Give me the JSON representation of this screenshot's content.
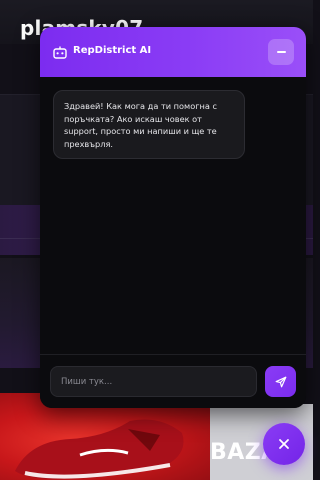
{
  "background": {
    "username": "plamsky07",
    "brand": "BAZAR"
  },
  "chat": {
    "title": "RepDistrict AI",
    "bot_icon": "robot-icon",
    "minimize_icon": "minus-icon",
    "welcome_message": "Здравей! Как мога да ти помогна с поръчката? Ако искаш човек от support, просто ми напиши и ще те прехвърля.",
    "input": {
      "placeholder": "Пиши тук...",
      "value": ""
    },
    "send_icon": "send-icon",
    "close_icon": "close-icon"
  },
  "colors": {
    "accent": "#8a3cf5",
    "header_gradient_start": "#7c2cf0",
    "header_gradient_end": "#9a4ff8",
    "chat_background": "#0b0b0e",
    "bubble_background": "#1a1a1e"
  }
}
